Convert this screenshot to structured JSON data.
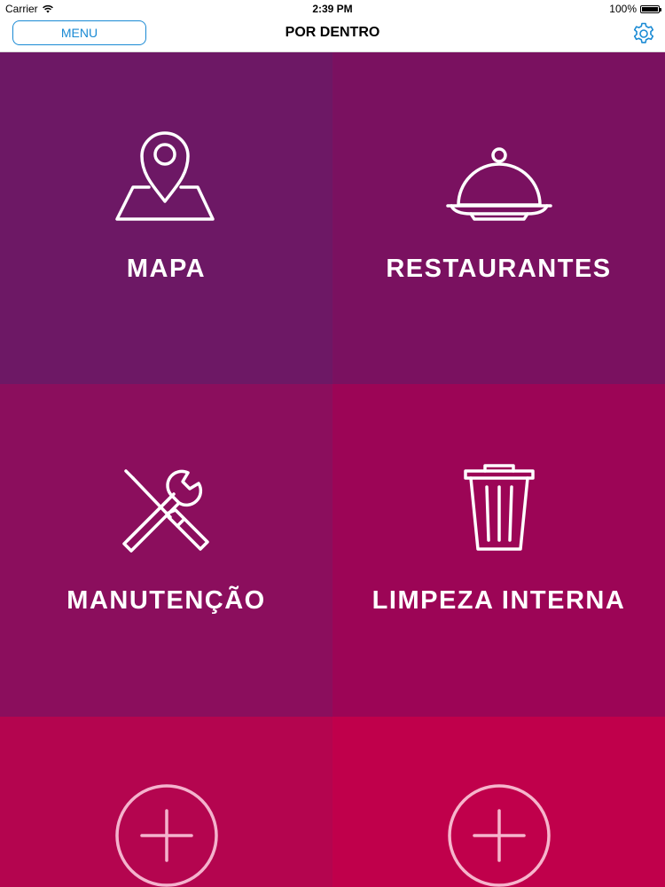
{
  "status_bar": {
    "carrier": "Carrier",
    "time": "2:39 PM",
    "battery": "100%"
  },
  "nav": {
    "menu_label": "MENU",
    "title": "POR DENTRO"
  },
  "tiles": [
    {
      "label": "MAPA",
      "icon": "map-pin-icon"
    },
    {
      "label": "RESTAURANTES",
      "icon": "food-cloche-icon"
    },
    {
      "label": "MANUTENÇÃO",
      "icon": "tools-icon"
    },
    {
      "label": "LIMPEZA INTERNA",
      "icon": "trash-can-icon"
    },
    {
      "label": "",
      "icon": "plus-circle-icon"
    },
    {
      "label": "",
      "icon": "plus-circle-icon"
    }
  ],
  "colors": {
    "accent": "#1a8ad4",
    "tile_1": "#6d1865",
    "tile_2": "#7a1160",
    "tile_3": "#8b0e5d",
    "tile_4": "#9c0556",
    "tile_5": "#b4054f",
    "tile_6": "#c0004b"
  }
}
